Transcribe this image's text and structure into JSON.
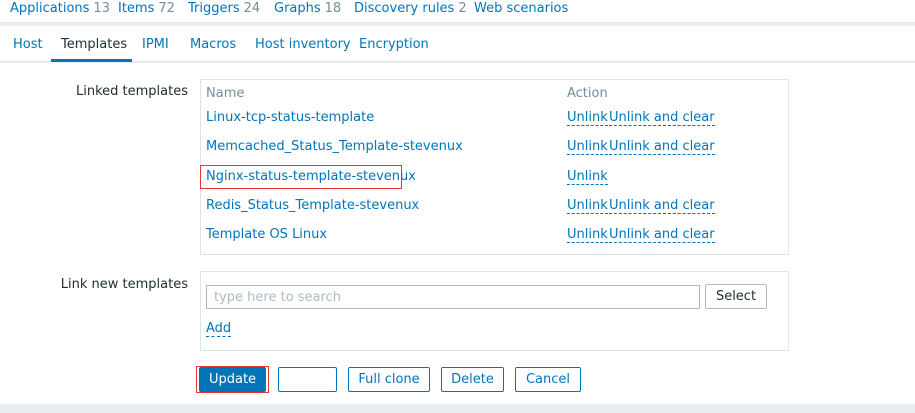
{
  "topnav": {
    "items": [
      {
        "label": "Applications",
        "count": "13"
      },
      {
        "label": "Items",
        "count": "72"
      },
      {
        "label": "Triggers",
        "count": "24"
      },
      {
        "label": "Graphs",
        "count": "18"
      },
      {
        "label": "Discovery rules",
        "count": "2"
      },
      {
        "label": "Web scenarios",
        "count": ""
      }
    ]
  },
  "tabs": [
    {
      "label": "Host"
    },
    {
      "label": "Templates"
    },
    {
      "label": "IPMI"
    },
    {
      "label": "Macros"
    },
    {
      "label": "Host inventory"
    },
    {
      "label": "Encryption"
    }
  ],
  "linked_templates": {
    "label": "Linked templates",
    "col_name": "Name",
    "col_action": "Action",
    "rows": [
      {
        "name": "Linux-tcp-status-template",
        "unlink": "Unlink",
        "unlink_clear": "Unlink and clear"
      },
      {
        "name": "Memcached_Status_Template-stevenux",
        "unlink": "Unlink",
        "unlink_clear": "Unlink and clear"
      },
      {
        "name": "Nginx-status-template-stevenux",
        "unlink": "Unlink",
        "unlink_clear": ""
      },
      {
        "name": "Redis_Status_Template-stevenux",
        "unlink": "Unlink",
        "unlink_clear": "Unlink and clear"
      },
      {
        "name": "Template OS Linux",
        "unlink": "Unlink",
        "unlink_clear": "Unlink and clear"
      }
    ]
  },
  "link_new": {
    "label": "Link new templates",
    "search_placeholder": "type here to search",
    "select_label": "Select",
    "add_label": "Add"
  },
  "buttons": {
    "update": "Update",
    "clone": "",
    "full_clone": "Full clone",
    "delete": "Delete",
    "cancel": "Cancel"
  },
  "colors": {
    "link": "#0275b8",
    "highlight": "#e33734"
  }
}
